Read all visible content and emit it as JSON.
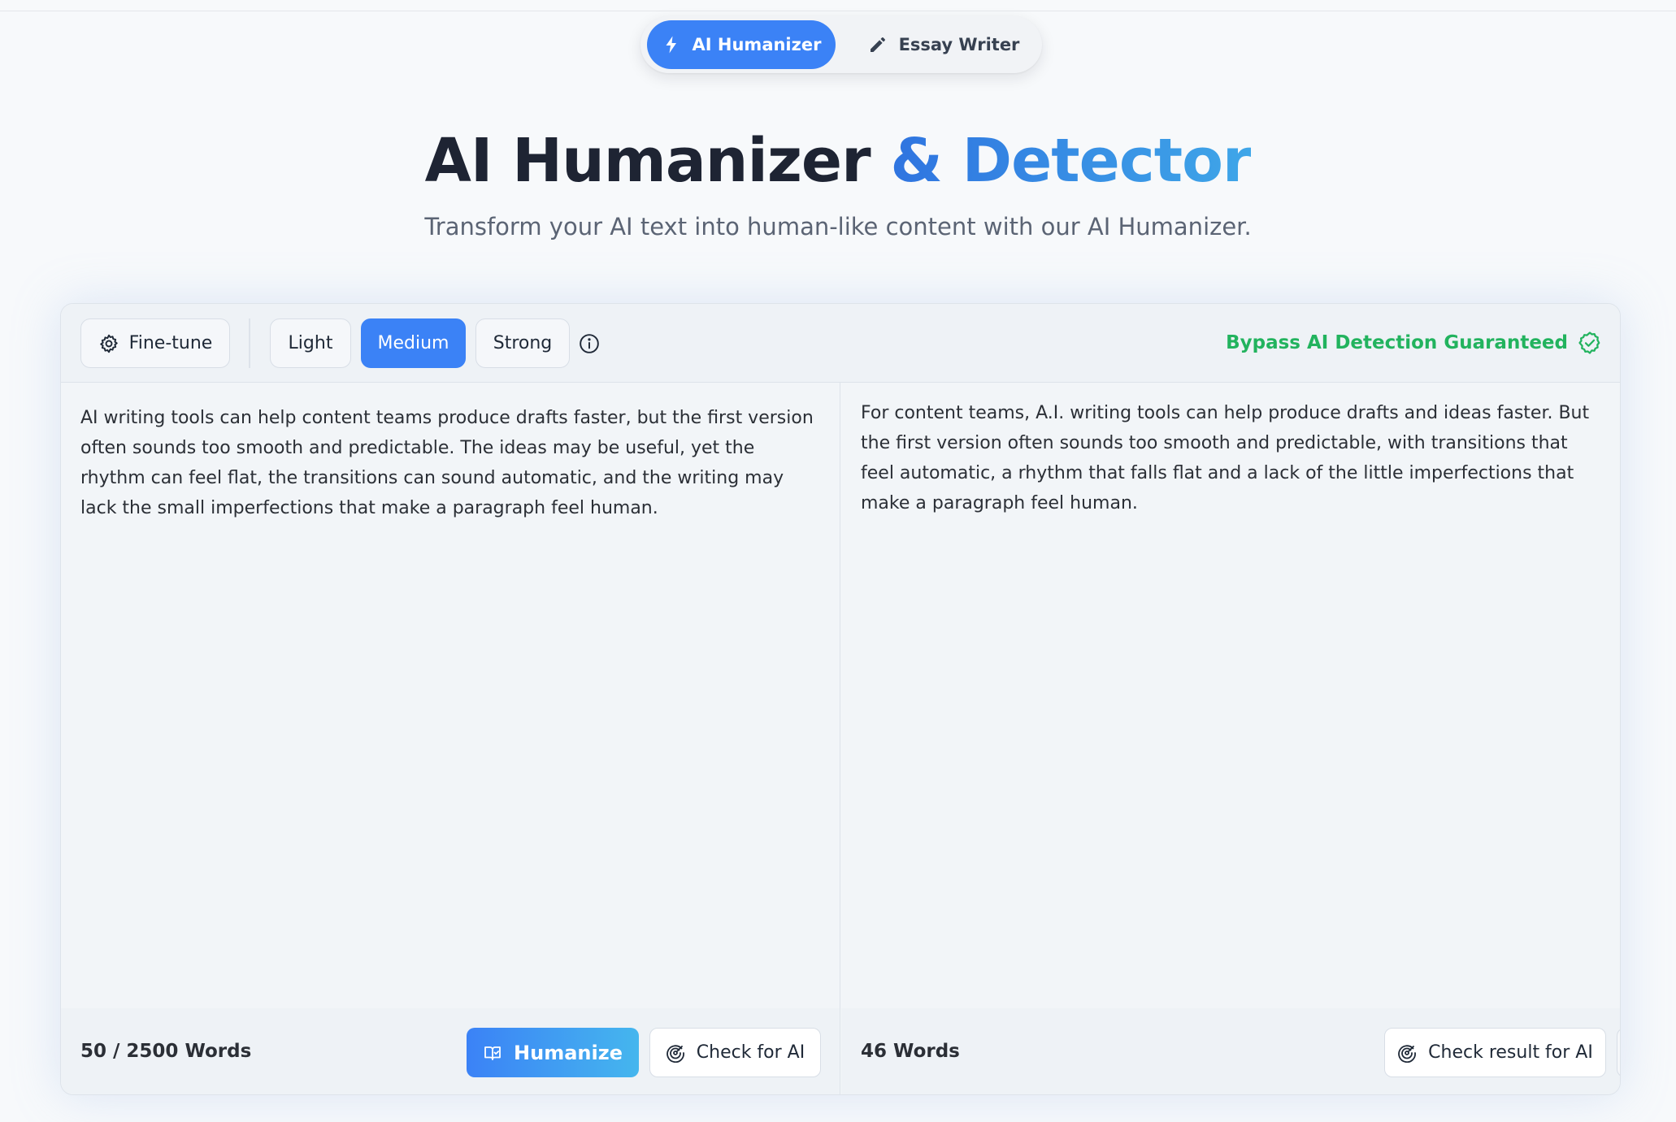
{
  "modes": {
    "humanizer_label": "AI Humanizer",
    "essay_label": "Essay Writer"
  },
  "header": {
    "title_main": "AI Humanizer",
    "title_accent": "& Detector",
    "subtitle": "Transform your AI text into human-like content with our AI Humanizer."
  },
  "toolbar": {
    "finetune_label": "Fine-tune",
    "levels": [
      "Light",
      "Medium",
      "Strong"
    ],
    "selected_level": "Medium",
    "bypass_label": "Bypass AI Detection Guaranteed"
  },
  "input": {
    "text": "AI writing tools can help content teams produce drafts faster, but the first version often sounds too smooth and predictable. The ideas may be useful, yet the rhythm can feel flat, the transitions can sound automatic, and the writing may lack the small imperfections that make a paragraph feel human.",
    "word_count": "50 / 2500 Words",
    "humanize_label": "Humanize",
    "check_label": "Check for AI"
  },
  "output": {
    "text": "For content teams, A.I. writing tools can help produce drafts and ideas faster. But the first version often sounds too smooth and predictable, with transitions that feel automatic, a rhythm that falls flat and a lack of the little imperfections that make a paragraph feel human.",
    "word_count": "46 Words",
    "check_result_label": "Check result for AI"
  },
  "colors": {
    "accent": "#3b82f6",
    "success": "#22b35e",
    "title": "#1e2433"
  },
  "icons": {
    "humanizer": "lightning-icon",
    "essay": "pencil-icon",
    "finetune": "gear-icon",
    "info": "info-icon",
    "bypass": "check-circle-icon",
    "humanize": "book-check-icon",
    "check": "radar-icon",
    "copy": "copy-icon"
  }
}
